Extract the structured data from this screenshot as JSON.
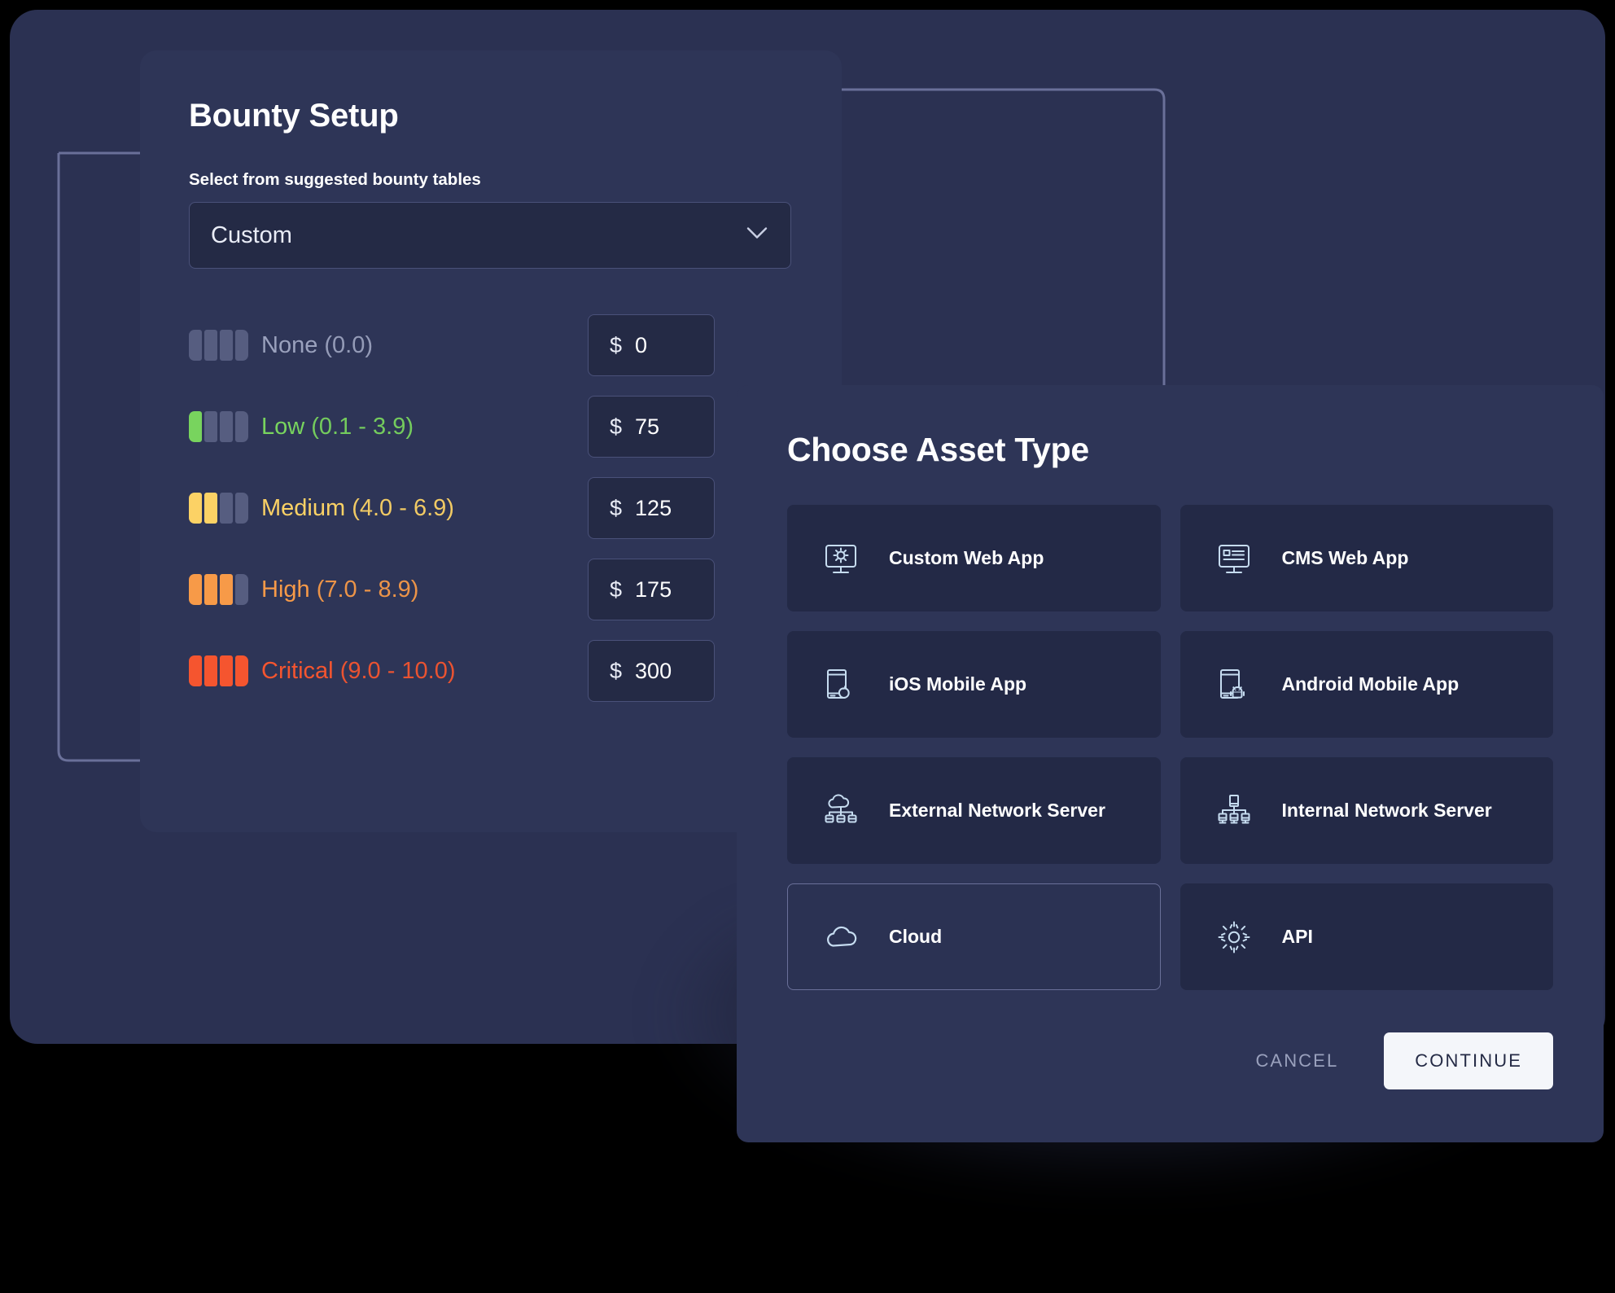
{
  "theme": {
    "page_bg": "#000000",
    "backdrop_bg": "#2b3152",
    "panel_bg": "#2e3557",
    "field_bg": "#242a45",
    "card_bg": "#232946",
    "border": "#4a5179",
    "icon_stroke": "#c6dcf0",
    "text_primary": "#ffffff",
    "text_muted": "#9aa1bd",
    "meter_empty": "#565d80",
    "accent_button_bg": "#f4f6fa",
    "accent_button_text": "#242a45"
  },
  "bounty_panel": {
    "title": "Bounty Setup",
    "select_label": "Select from suggested bounty tables",
    "select": {
      "value": "Custom",
      "chevron_icon": "chevron-down-icon",
      "options": [
        "Custom"
      ]
    },
    "currency_symbol": "$",
    "severities": [
      {
        "name": "None",
        "range": "(0.0)",
        "filled": 0,
        "color": "#9aa1bd",
        "amount": "0"
      },
      {
        "name": "Low",
        "range": "(0.1 - 3.9)",
        "filled": 1,
        "color": "#78d45e",
        "amount": "75"
      },
      {
        "name": "Medium",
        "range": "(4.0 - 6.9)",
        "filled": 2,
        "color": "#fcd265",
        "amount": "125"
      },
      {
        "name": "High",
        "range": "(7.0 - 8.9)",
        "filled": 3,
        "color": "#f79a48",
        "amount": "175"
      },
      {
        "name": "Critical",
        "range": "(9.0 - 10.0)",
        "filled": 4,
        "color": "#f5552f",
        "amount": "300"
      }
    ]
  },
  "asset_modal": {
    "title": "Choose Asset Type",
    "assets": [
      {
        "label": "Custom Web App",
        "icon": "monitor-gear-icon",
        "selected": false
      },
      {
        "label": "CMS Web App",
        "icon": "monitor-content-icon",
        "selected": false
      },
      {
        "label": "iOS Mobile App",
        "icon": "phone-apple-icon",
        "selected": false
      },
      {
        "label": "Android Mobile App",
        "icon": "phone-android-icon",
        "selected": false
      },
      {
        "label": "External Network Server",
        "icon": "cloud-network-icon",
        "selected": false
      },
      {
        "label": "Internal Network Server",
        "icon": "network-tree-icon",
        "selected": false
      },
      {
        "label": "Cloud",
        "icon": "cloud-icon",
        "selected": true
      },
      {
        "label": "API",
        "icon": "gear-icon",
        "selected": false
      }
    ],
    "footer": {
      "cancel_label": "CANCEL",
      "continue_label": "CONTINUE"
    }
  }
}
